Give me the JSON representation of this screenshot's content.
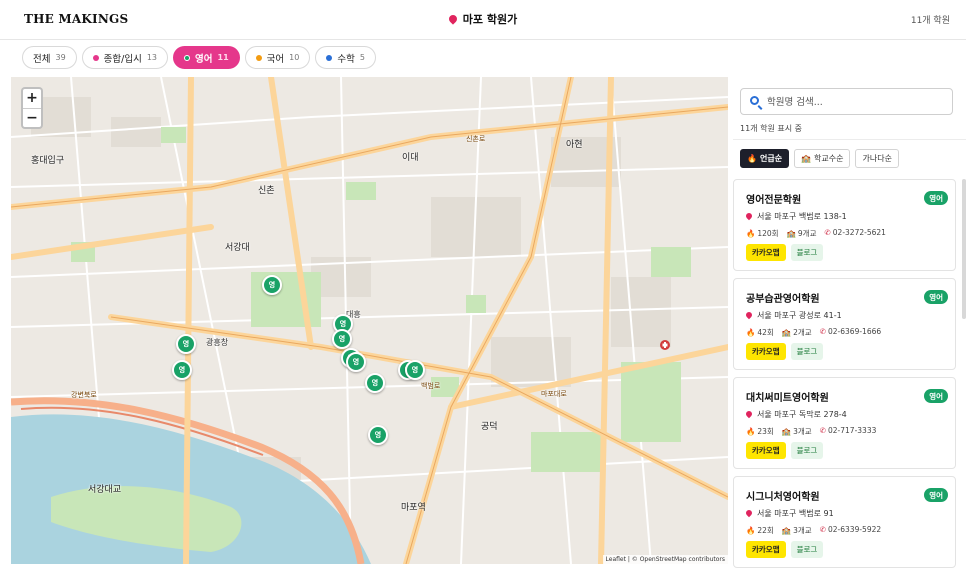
{
  "header": {
    "brand": "THE MAKINGS",
    "location": "마포 학원가",
    "total_count": "11개 학원"
  },
  "filters": [
    {
      "label": "전체",
      "count": "39",
      "dot": ""
    },
    {
      "label": "종합/입시",
      "count": "13",
      "dot": "#e5378b"
    },
    {
      "label": "영어",
      "count": "11",
      "dot": "#19a267"
    },
    {
      "label": "국어",
      "count": "10",
      "dot": "#f39c12"
    },
    {
      "label": "수학",
      "count": "5",
      "dot": "#2a6fd6"
    }
  ],
  "map": {
    "zoom_in": "+",
    "zoom_out": "−",
    "attribution": "Leaflet | © OpenStreetMap contributors",
    "marker_label": "영",
    "labels": {
      "l1": "홍대입구",
      "l2": "서강대",
      "l3": "신촌",
      "l4": "이대",
      "l5": "마포역",
      "l6": "서강대교",
      "l7": "아현",
      "l8": "공덕",
      "l9": "신촌로",
      "l10": "마포대로",
      "l11": "강변북로",
      "l12": "백범로",
      "l13": "대흥",
      "l14": "광흥창"
    }
  },
  "sidebar": {
    "search_placeholder": "학원명 검색...",
    "shown_text": "11개 학원 표시 중",
    "sorts": [
      {
        "label": "언급순",
        "icon": "🔥"
      },
      {
        "label": "학교수순",
        "icon": "🏫"
      },
      {
        "label": "가나다순",
        "icon": ""
      }
    ],
    "cards": [
      {
        "name": "영어전문학원",
        "badge": "영어",
        "address": "서울 마포구 백범로 138-1",
        "mentions": "120회",
        "schools": "9개교",
        "phone": "02-3272-5621",
        "kakao": "카카오맵",
        "blog": "블로그"
      },
      {
        "name": "공부습관영어학원",
        "badge": "영어",
        "address": "서울 마포구 광성로 41-1",
        "mentions": "42회",
        "schools": "2개교",
        "phone": "02-6369-1666",
        "kakao": "카카오맵",
        "blog": "블로그"
      },
      {
        "name": "대치써미트영어학원",
        "badge": "영어",
        "address": "서울 마포구 독막로 278-4",
        "mentions": "23회",
        "schools": "3개교",
        "phone": "02-717-3333",
        "kakao": "카카오맵",
        "blog": "블로그"
      },
      {
        "name": "시그니처영어학원",
        "badge": "영어",
        "address": "서울 마포구 백범로 91",
        "mentions": "22회",
        "schools": "3개교",
        "phone": "02-6339-5922",
        "kakao": "카카오맵",
        "blog": "블로그"
      }
    ]
  },
  "colors": {
    "accent": "#e5378b",
    "english_green": "#19a267",
    "kakao_yellow": "#fee500"
  }
}
